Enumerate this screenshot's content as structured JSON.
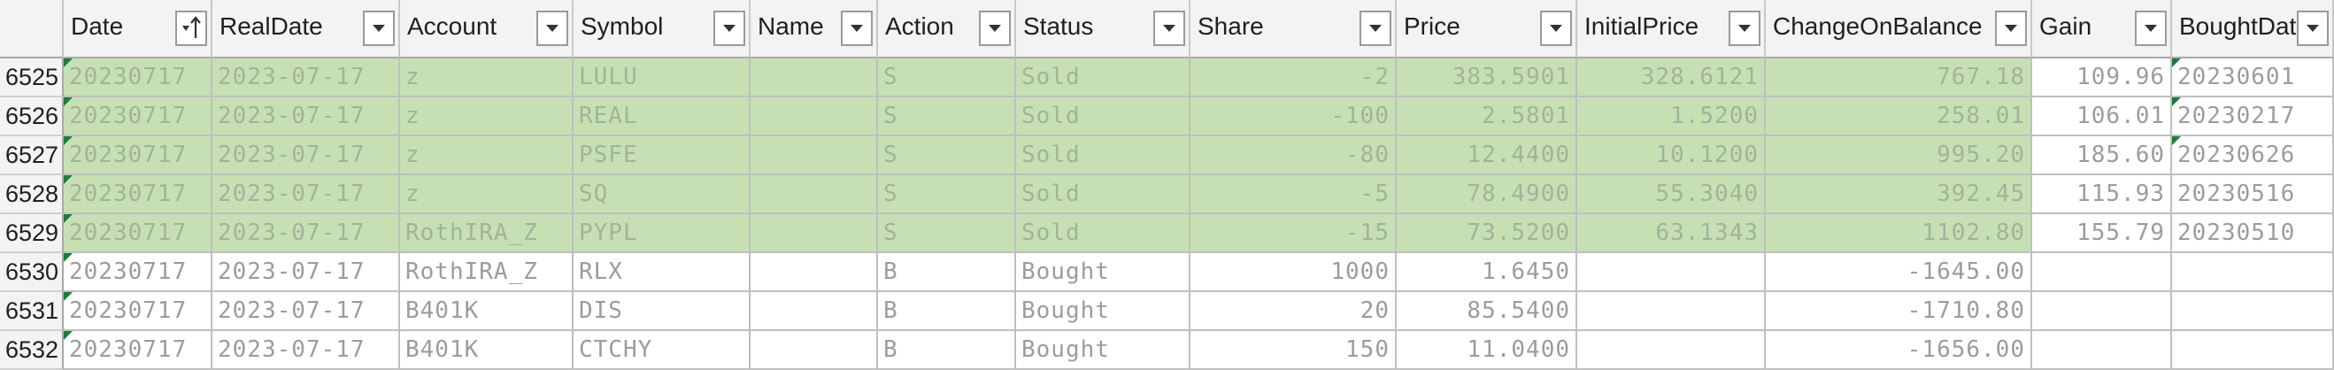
{
  "columns": [
    {
      "key": "date",
      "label": "Date",
      "sort": true
    },
    {
      "key": "realdate",
      "label": "RealDate"
    },
    {
      "key": "account",
      "label": "Account"
    },
    {
      "key": "symbol",
      "label": "Symbol"
    },
    {
      "key": "name",
      "label": "Name"
    },
    {
      "key": "action",
      "label": "Action"
    },
    {
      "key": "status",
      "label": "Status"
    },
    {
      "key": "share",
      "label": "Share"
    },
    {
      "key": "price",
      "label": "Price"
    },
    {
      "key": "initialprice",
      "label": "InitialPrice"
    },
    {
      "key": "changeonbalance",
      "label": "ChangeOnBalance"
    },
    {
      "key": "gain",
      "label": "Gain"
    },
    {
      "key": "boughtdate",
      "label": "BoughtDat"
    }
  ],
  "rows": [
    {
      "num": "6525",
      "highlight": true,
      "date": "20230717",
      "realdate": "2023-07-17",
      "account": "z",
      "symbol": "LULU",
      "name": "",
      "action": "S",
      "status": "Sold",
      "share": "-2",
      "price": "383.5901",
      "initialprice": "328.6121",
      "changeonbalance": "767.18",
      "gain": "109.96",
      "boughtdate": "20230601"
    },
    {
      "num": "6526",
      "highlight": true,
      "date": "20230717",
      "realdate": "2023-07-17",
      "account": "z",
      "symbol": "REAL",
      "name": "",
      "action": "S",
      "status": "Sold",
      "share": "-100",
      "price": "2.5801",
      "initialprice": "1.5200",
      "changeonbalance": "258.01",
      "gain": "106.01",
      "boughtdate": "20230217"
    },
    {
      "num": "6527",
      "highlight": true,
      "date": "20230717",
      "realdate": "2023-07-17",
      "account": "z",
      "symbol": "PSFE",
      "name": "",
      "action": "S",
      "status": "Sold",
      "share": "-80",
      "price": "12.4400",
      "initialprice": "10.1200",
      "changeonbalance": "995.20",
      "gain": "185.60",
      "boughtdate": "20230626"
    },
    {
      "num": "6528",
      "highlight": true,
      "date": "20230717",
      "realdate": "2023-07-17",
      "account": "z",
      "symbol": "SQ",
      "name": "",
      "action": "S",
      "status": "Sold",
      "share": "-5",
      "price": "78.4900",
      "initialprice": "55.3040",
      "changeonbalance": "392.45",
      "gain": "115.93",
      "boughtdate": "20230516"
    },
    {
      "num": "6529",
      "highlight": true,
      "date": "20230717",
      "realdate": "2023-07-17",
      "account": "RothIRA_Z",
      "symbol": "PYPL",
      "name": "",
      "action": "S",
      "status": "Sold",
      "share": "-15",
      "price": "73.5200",
      "initialprice": "63.1343",
      "changeonbalance": "1102.80",
      "gain": "155.79",
      "boughtdate": "20230510"
    },
    {
      "num": "6530",
      "highlight": false,
      "date": "20230717",
      "realdate": "2023-07-17",
      "account": "RothIRA_Z",
      "symbol": "RLX",
      "name": "",
      "action": "B",
      "status": "Bought",
      "share": "1000",
      "price": "1.6450",
      "initialprice": "",
      "changeonbalance": "-1645.00",
      "gain": "",
      "boughtdate": ""
    },
    {
      "num": "6531",
      "highlight": false,
      "date": "20230717",
      "realdate": "2023-07-17",
      "account": "B401K",
      "symbol": "DIS",
      "name": "",
      "action": "B",
      "status": "Bought",
      "share": "20",
      "price": "85.5400",
      "initialprice": "",
      "changeonbalance": "-1710.80",
      "gain": "",
      "boughtdate": ""
    },
    {
      "num": "6532",
      "highlight": false,
      "date": "20230717",
      "realdate": "2023-07-17",
      "account": "B401K",
      "symbol": "CTCHY",
      "name": "",
      "action": "B",
      "status": "Bought",
      "share": "150",
      "price": "11.0400",
      "initialprice": "",
      "changeonbalance": "-1656.00",
      "gain": "",
      "boughtdate": ""
    }
  ],
  "colors": {
    "highlight": "#c6e0b4",
    "header": "#f3f3f3",
    "grid": "#bfbfbf",
    "error_marker": "#1e7b3b"
  }
}
